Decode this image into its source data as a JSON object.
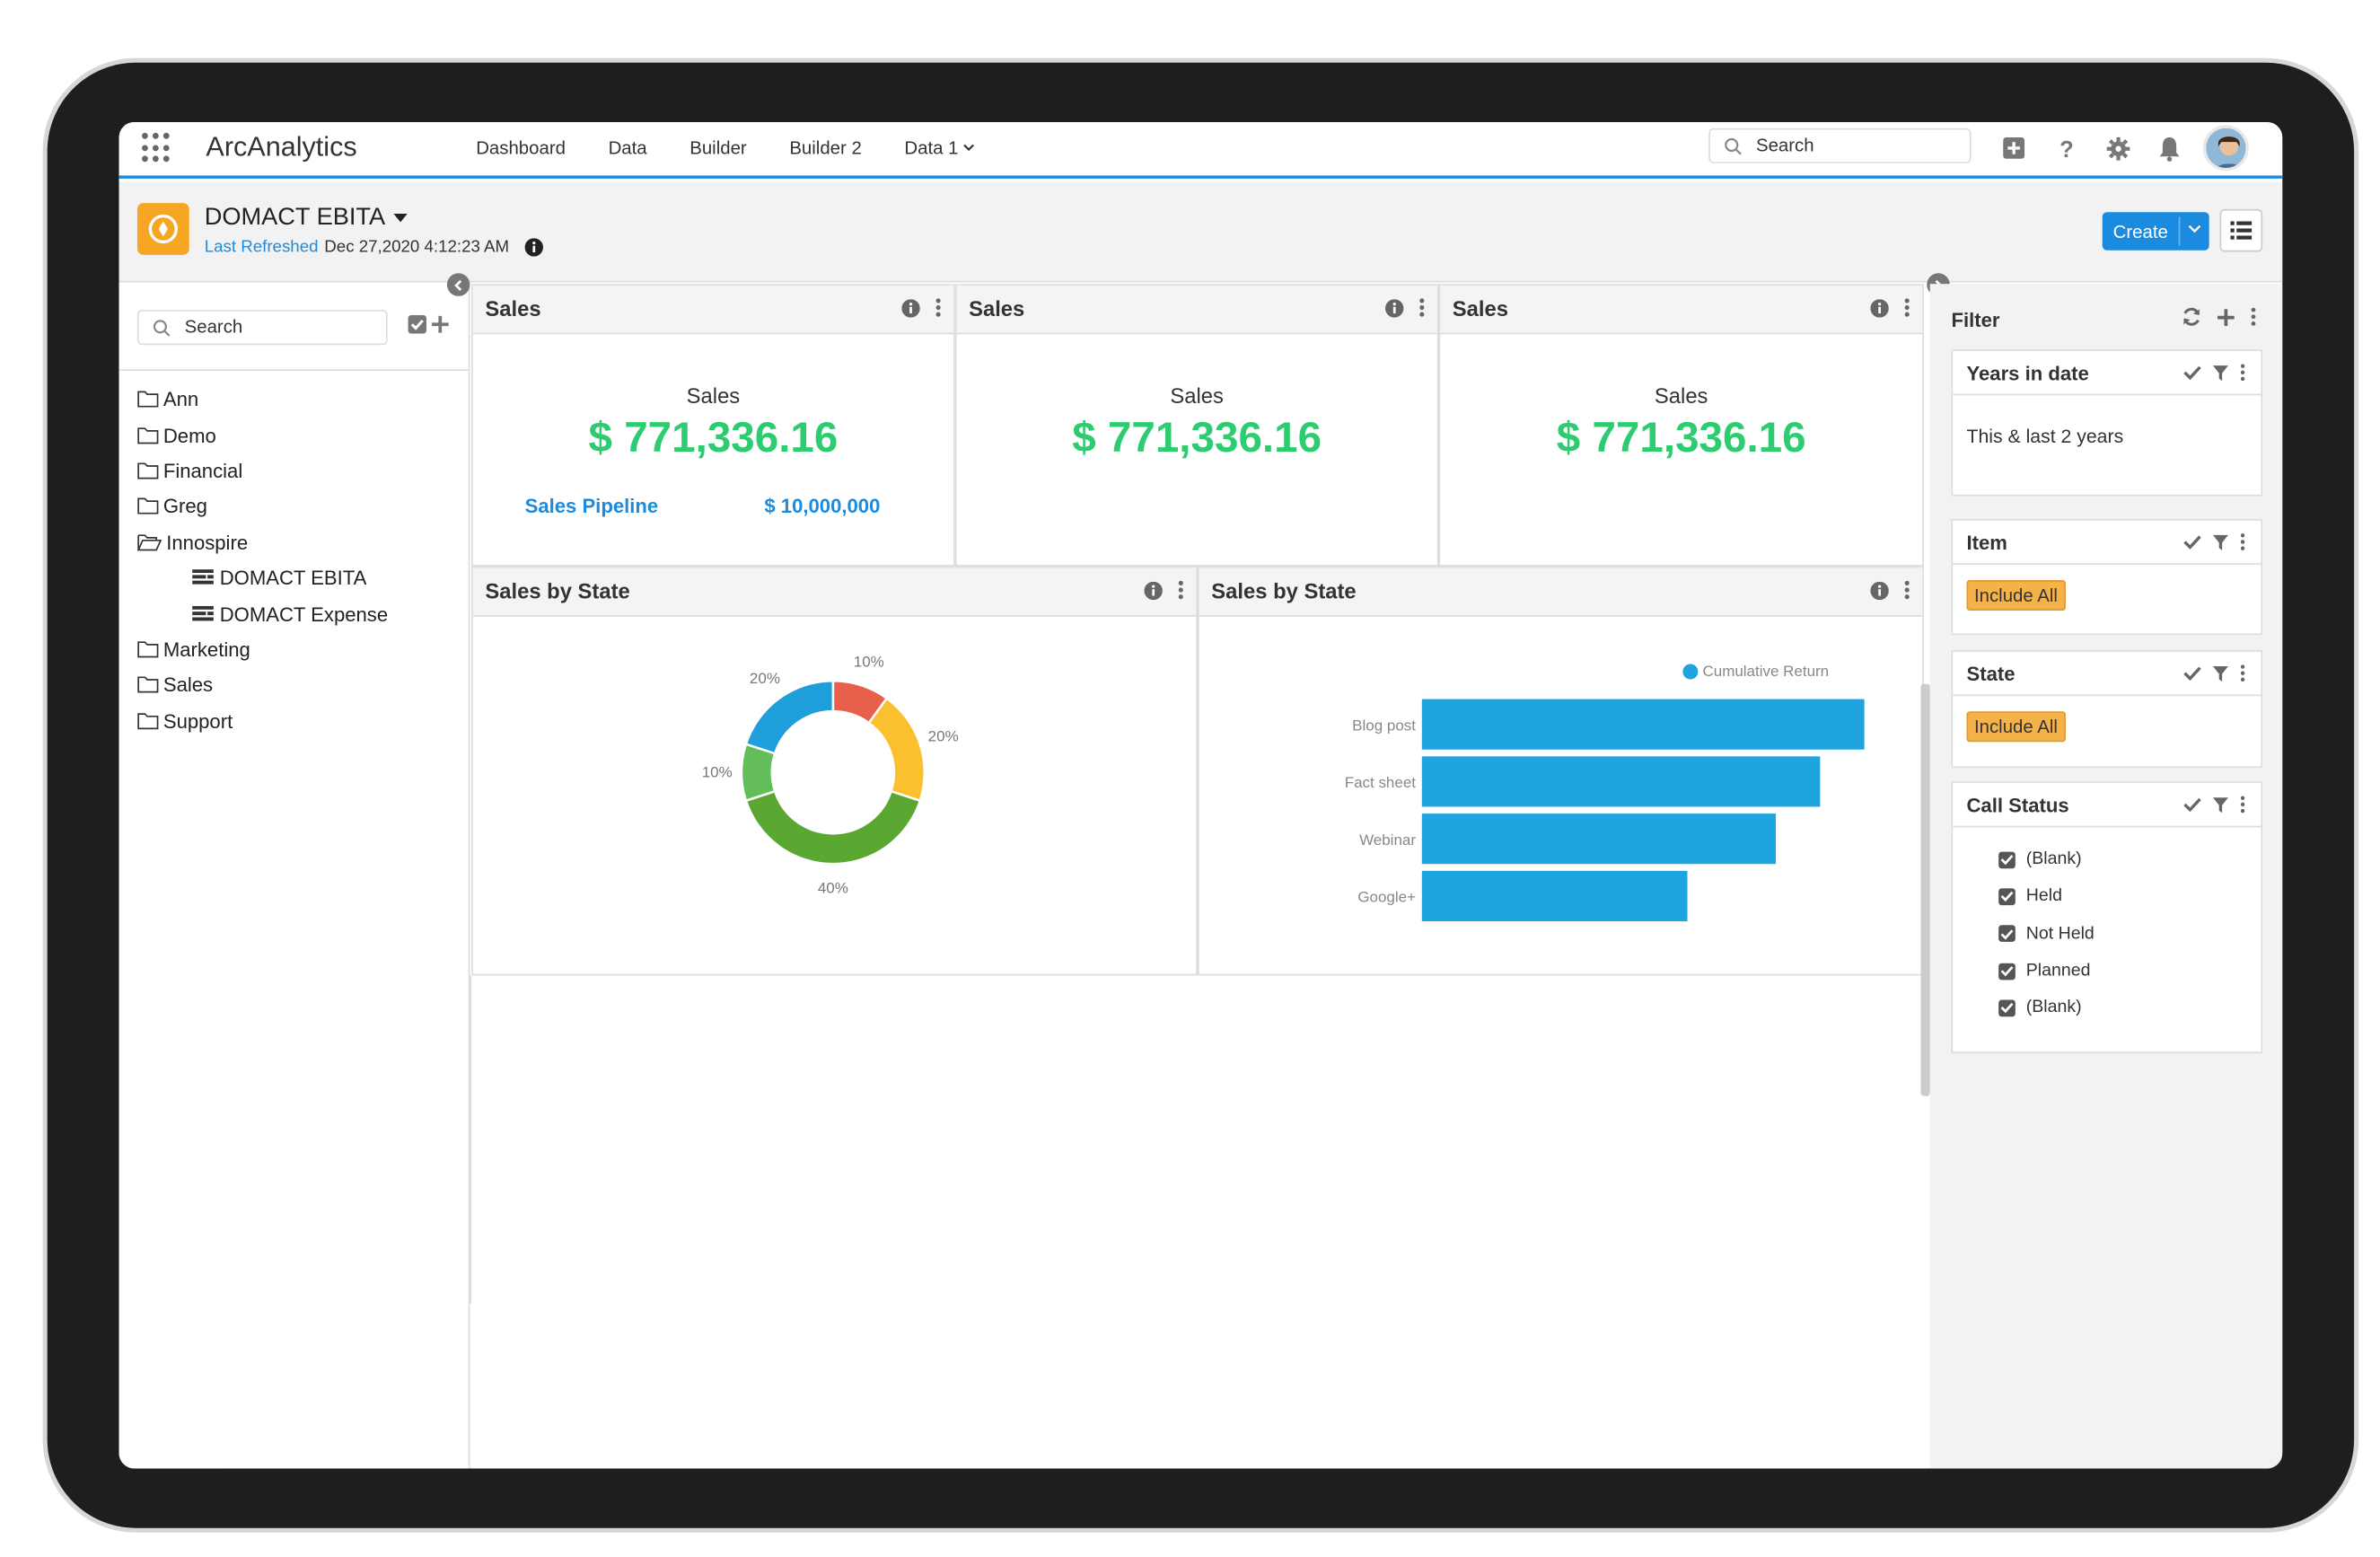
{
  "app": {
    "name": "ArcAnalytics"
  },
  "nav": [
    {
      "label": "Dashboard"
    },
    {
      "label": "Data"
    },
    {
      "label": "Builder"
    },
    {
      "label": "Builder 2"
    },
    {
      "label": "Data 1"
    }
  ],
  "search": {
    "placeholder": "Search"
  },
  "icons": [
    "add-icon",
    "help-icon",
    "gear-icon",
    "bell-icon",
    "avatar"
  ],
  "header": {
    "title": "DOMACT EBITA",
    "refresh_label": "Last Refreshed",
    "refresh_time": "Dec 27,2020 4:12:23 AM",
    "create_label": "Create"
  },
  "sidebar": {
    "search_placeholder": "Search",
    "items": [
      {
        "label": "Ann",
        "level": 0,
        "open": false
      },
      {
        "label": "Demo",
        "level": 0,
        "open": false
      },
      {
        "label": "Financial",
        "level": 0,
        "open": false
      },
      {
        "label": "Greg",
        "level": 0,
        "open": false
      },
      {
        "label": "Innospire",
        "level": 0,
        "open": true
      },
      {
        "label": "DOMACT EBITA",
        "level": 1
      },
      {
        "label": "DOMACT Expense",
        "level": 1
      },
      {
        "label": "Marketing",
        "level": 0,
        "open": false
      },
      {
        "label": "Sales",
        "level": 0,
        "open": false
      },
      {
        "label": "Support",
        "level": 0,
        "open": false
      }
    ]
  },
  "widgets": {
    "kpi": [
      {
        "title": "Sales",
        "label": "Sales",
        "value": "$ 771,336.16",
        "pipeline_label": "Sales Pipeline",
        "pipeline_value": "$ 10,000,000"
      },
      {
        "title": "Sales",
        "label": "Sales",
        "value": "$ 771,336.16"
      },
      {
        "title": "Sales",
        "label": "Sales",
        "value": "$ 771,336.16"
      }
    ],
    "donut_title": "Sales by State",
    "bar_title": "Sales by State"
  },
  "chart_data": [
    {
      "type": "pie",
      "categories": [
        "",
        "",
        "",
        "",
        ""
      ],
      "values": [
        10,
        20,
        40,
        10,
        20
      ],
      "labels": [
        "10%",
        "20%",
        "40%",
        "10%",
        "20%"
      ],
      "colors": [
        "#e8604c",
        "#fbc02d",
        "#5aa832",
        "#62bd5a",
        "#1e9edb"
      ]
    },
    {
      "type": "bar",
      "orientation": "horizontal",
      "categories": [
        "Blog post",
        "Fact sheet",
        "Webinar",
        "Google+"
      ],
      "series": [
        {
          "name": "Cumulative Return",
          "values": [
            100,
            90,
            80,
            60
          ],
          "color": "#1ea4de"
        }
      ],
      "legend": "top-right"
    }
  ],
  "filter": {
    "title": "Filter",
    "cards": [
      {
        "title": "Years in date",
        "value": "This & last 2 years"
      },
      {
        "title": "Item",
        "pill": "Include All"
      },
      {
        "title": "State",
        "pill": "Include All"
      },
      {
        "title": "Call Status",
        "options": [
          "(Blank)",
          "Held",
          "Not Held",
          "Planned",
          "(Blank)"
        ]
      }
    ]
  }
}
